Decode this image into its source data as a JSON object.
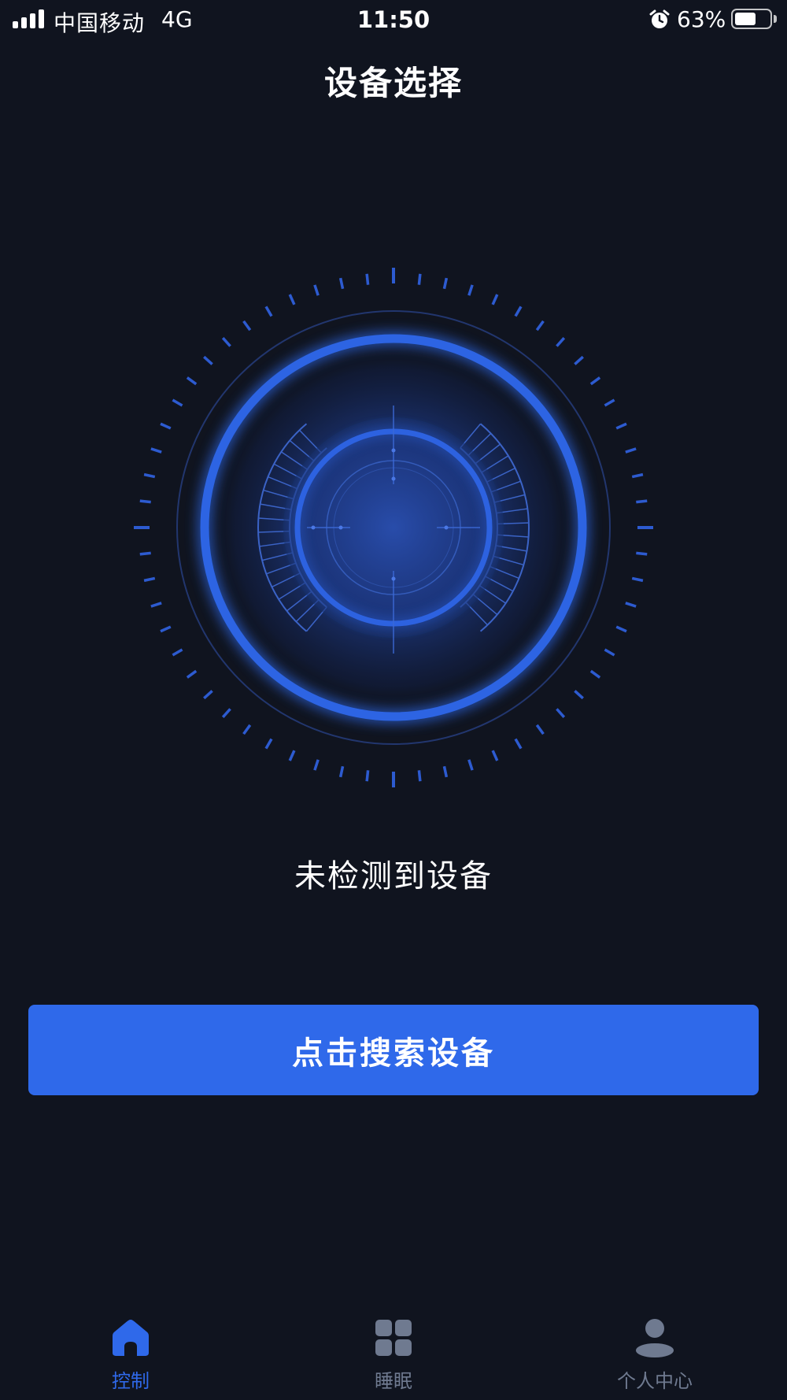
{
  "status_bar": {
    "carrier": "中国移动",
    "network": "4G",
    "time": "11:50",
    "battery_percent": "63%",
    "battery_level": 0.63,
    "icons": [
      "signal-icon",
      "alarm-icon",
      "battery-icon"
    ]
  },
  "header": {
    "title": "设备选择"
  },
  "main": {
    "status_text": "未检测到设备",
    "search_button_label": "点击搜索设备"
  },
  "tab_bar": {
    "active_color": "#2f69ea",
    "inactive_color": "#6f7a90",
    "tabs": [
      {
        "label": "控制",
        "icon": "home-icon",
        "active": true
      },
      {
        "label": "睡眠",
        "icon": "grid-icon",
        "active": false
      },
      {
        "label": "个人中心",
        "icon": "person-icon",
        "active": false
      }
    ]
  },
  "colors": {
    "background": "#10141f",
    "accent": "#2f69ea"
  }
}
